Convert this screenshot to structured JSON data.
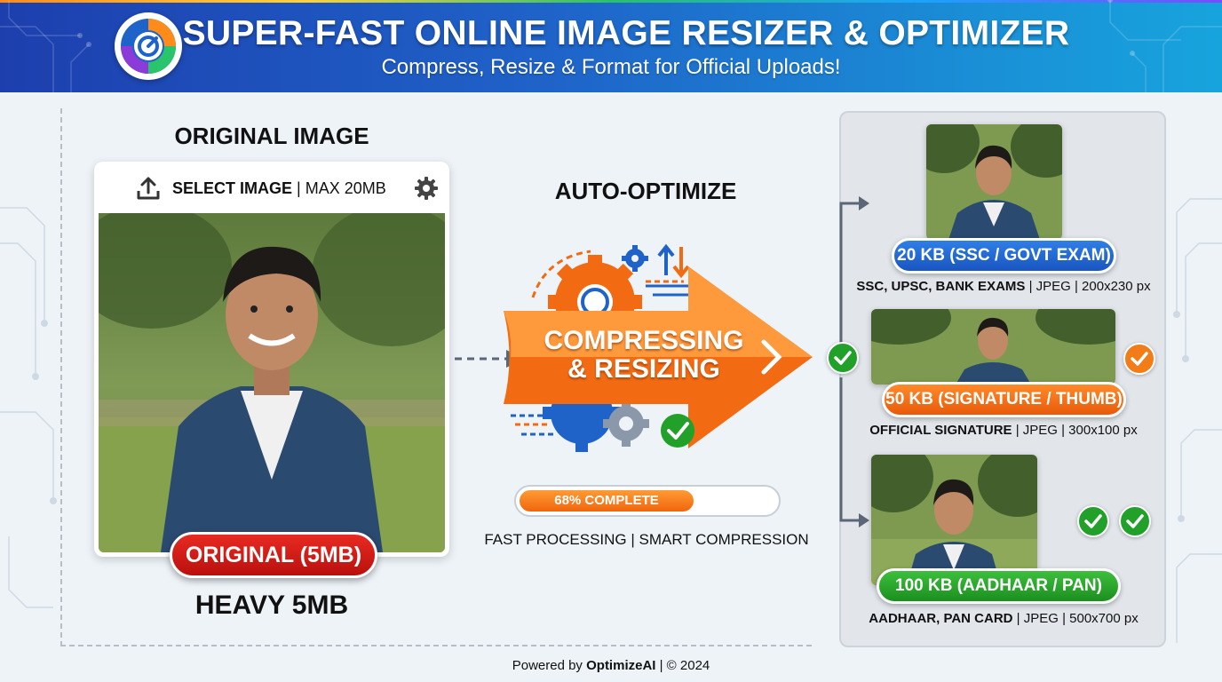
{
  "header": {
    "title": "SUPER-FAST ONLINE IMAGE RESIZER & OPTIMIZER",
    "subtitle": "Compress, Resize & Format for Official Uploads!"
  },
  "original": {
    "heading": "ORIGINAL IMAGE",
    "select_label": "SELECT IMAGE",
    "max_label": "| MAX 20MB",
    "badge": "ORIGINAL (5MB)",
    "size_caption": "HEAVY 5MB"
  },
  "process": {
    "heading": "AUTO-OPTIMIZE",
    "arrow_line1": "COMPRESSING",
    "arrow_line2": "& RESIZING",
    "progress_label": "68% COMPLETE",
    "progress_value": 0.68,
    "caption": "FAST PROCESSING | SMART COMPRESSION"
  },
  "outputs": [
    {
      "badge": "20 KB (SSC / GOVT EXAM)",
      "desc_bold": "SSC, UPSC, BANK EXAMS",
      "desc_rest": " | JPEG | 200x230 px",
      "color": "#1f63d0"
    },
    {
      "badge": "50 KB (SIGNATURE / THUMB)",
      "desc_bold": "OFFICIAL SIGNATURE",
      "desc_rest": " | JPEG | 300x100 px",
      "color": "#f06a12"
    },
    {
      "badge": "100 KB (AADHAAR / PAN)",
      "desc_bold": "AADHAAR, PAN CARD",
      "desc_rest": " | JPEG | 500x700 px",
      "color": "#23a024"
    }
  ],
  "footer": {
    "prefix": "Powered by ",
    "brand": "OptimizeAI",
    "suffix": " | © 2024"
  },
  "icons": [
    "logo-icon",
    "upload-icon",
    "gear-icon",
    "arrow-right-icon",
    "check-icon"
  ],
  "colors": {
    "header_start": "#1d3fae",
    "header_end": "#17a4dd",
    "red_badge": "#d41c17",
    "orange_arrow": "#f26b12",
    "green_check": "#1f9a24"
  }
}
